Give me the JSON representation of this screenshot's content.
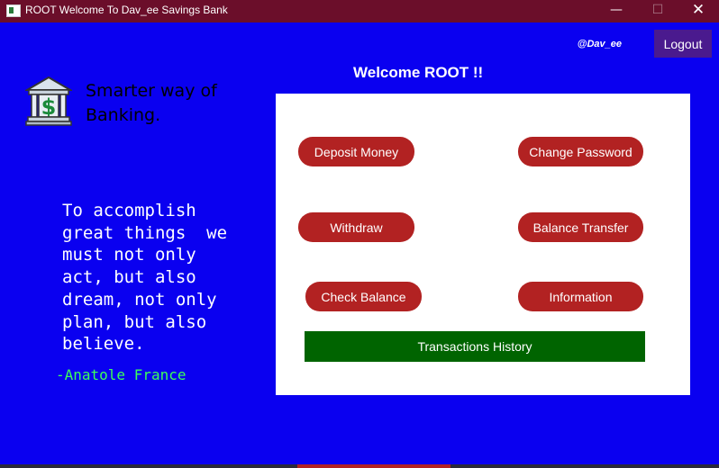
{
  "window": {
    "title": "ROOT Welcome To Dav_ee Savings Bank",
    "icon": "app-icon",
    "controls": {
      "minimize": "—",
      "maximize": "☐",
      "close": "✕"
    }
  },
  "header": {
    "handle": "@Dav_ee",
    "logout_label": "Logout",
    "welcome": "Welcome ROOT !!"
  },
  "branding": {
    "icon": "bank-icon",
    "tagline": "Smarter way of Banking."
  },
  "quote": {
    "text": "To accomplish\ngreat things  we\nmust not only\nact, but also\ndream, not only\nplan, but also\nbelieve.",
    "author": "-Anatole France"
  },
  "actions": {
    "deposit": "Deposit Money",
    "change_password": "Change Password",
    "withdraw": "Withdraw",
    "balance_transfer": "Balance Transfer",
    "check_balance": "Check Balance",
    "information": "Information",
    "history": "Transactions History"
  },
  "colors": {
    "background": "#0a00f0",
    "titlebar": "#6b0e2a",
    "action_button": "#b22222",
    "history_button": "#006400",
    "logout_button": "#4a1a8e",
    "quote_author": "#3cff5a"
  }
}
